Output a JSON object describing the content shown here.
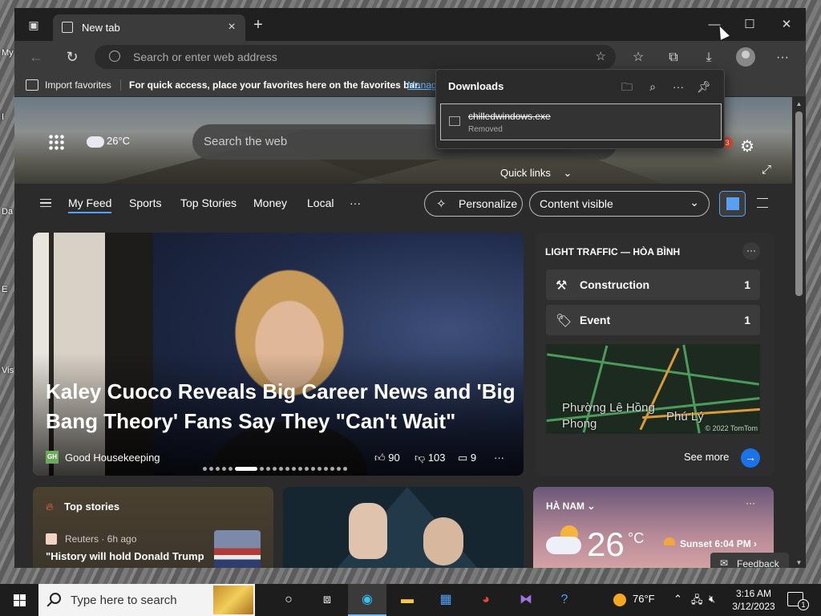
{
  "desktop": {
    "labels": [
      "My",
      "I",
      "Da",
      "E",
      "Vis"
    ]
  },
  "browser": {
    "tab": {
      "title": "New tab",
      "close": "×"
    },
    "new_tab": "+",
    "window_controls": {
      "minimize": "—",
      "maximize": "☐",
      "close": "✕"
    },
    "address": {
      "placeholder": "Search or enter web address"
    },
    "favorites_bar": {
      "import": "Import favorites",
      "tip": "For quick access, place your favorites here on the favorites bar.",
      "manage": "Manag"
    }
  },
  "newtab": {
    "weather_mini": "26°C",
    "search_placeholder": "Search the web",
    "notification_count": "3",
    "quick_links": "Quick links",
    "feed_tabs": [
      "My Feed",
      "Sports",
      "Top Stories",
      "Money",
      "Local",
      "···"
    ],
    "personalize": "Personalize",
    "content_visible": "Content visible"
  },
  "main_story": {
    "headline": "Kaley Cuoco Reveals Big Career News and 'Big Bang Theory' Fans Say They \"Can't Wait\"",
    "source_logo": "GH",
    "source": "Good Housekeeping",
    "likes": "90",
    "dislikes": "103",
    "comments": "9",
    "more": "···",
    "carousel_total": 20,
    "carousel_active": 6
  },
  "traffic": {
    "title": "LIGHT TRAFFIC — HÒA BÌNH",
    "more": "···",
    "rows": [
      {
        "label": "Construction",
        "count": "1",
        "icon": "construction-icon"
      },
      {
        "label": "Event",
        "count": "1",
        "icon": "event-tag-icon"
      }
    ],
    "map_places": [
      "Phường Lê Hồng Phong",
      "Phú Lý"
    ],
    "map_credit": "© 2022 TomTom",
    "see_more": "See more"
  },
  "top_stories": {
    "title": "Top stories",
    "source": "Reuters · 6h ago",
    "headline": "\"History will hold Donald Trump accountable\" for Jan. ..."
  },
  "weather_card": {
    "location": "HÀ NAM",
    "temp": "26",
    "unit": "°C",
    "sunset": "Sunset 6:04 PM",
    "more": "···"
  },
  "feedback": "Feedback",
  "downloads": {
    "title": "Downloads",
    "file_name": "chilledwindows.exe",
    "status": "Removed"
  },
  "taskbar": {
    "search_placeholder": "Type here to search",
    "weather": "76°F",
    "time": "3:16 AM",
    "date": "3/12/2023",
    "notifications": "1"
  },
  "colors": {
    "accent": "#5aa0f0",
    "see_more_button": "#1a73e8",
    "taskbar": "#1d1d1d",
    "page_bg": "#2b2b2b"
  }
}
